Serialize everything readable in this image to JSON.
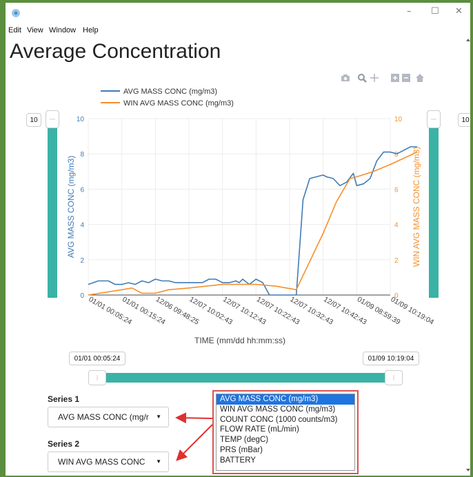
{
  "window": {
    "controls": {
      "minimize": "–",
      "maximize": "☐",
      "close": "✕"
    }
  },
  "menu": [
    "Edit",
    "View",
    "Window",
    "Help"
  ],
  "page": {
    "title": "Average Concentration"
  },
  "toolbar_icons": [
    "camera-icon",
    "zoom-icon",
    "pan-icon",
    "zoom-in-icon",
    "zoom-out-icon",
    "home-icon"
  ],
  "left_axis_slider": {
    "value": "10",
    "level": 1.0
  },
  "right_axis_slider": {
    "value": "10",
    "level": 1.0
  },
  "time_range": {
    "start": "01/01 00:05:24",
    "end": "01/09 10:19:04",
    "start_pos": 0.0,
    "end_pos": 1.0
  },
  "series_controls": {
    "series1": {
      "label": "Series 1",
      "value": "AVG MASS CONC (mg/r"
    },
    "series2": {
      "label": "Series 2",
      "value": "WIN AVG MASS CONC"
    }
  },
  "dropdown": {
    "options": [
      "AVG MASS CONC (mg/m3)",
      "WIN AVG MASS CONC (mg/m3)",
      "COUNT CONC (1000 counts/m3)",
      "FLOW RATE (mL/min)",
      "TEMP (degC)",
      "PRS (mBar)",
      "BATTERY"
    ],
    "selected": 0
  },
  "colors": {
    "series1": "#3f7bb5",
    "series2": "#f58f2d",
    "slider": "#3ab3a6",
    "annotation": "#d9534f",
    "selected": "#1e74e0"
  },
  "chart_data": {
    "type": "line",
    "xlabel": "TIME (mm/dd hh:mm:ss)",
    "ylabel": "AVG MASS CONC (mg/m3)",
    "y2label": "WIN AVG MASS CONC (mg/m3)",
    "ylim": [
      0,
      10
    ],
    "y2lim": [
      0,
      10
    ],
    "yticks": [
      0,
      2,
      4,
      6,
      8,
      10
    ],
    "y2ticks": [
      0,
      2,
      4,
      6,
      8,
      10
    ],
    "xticks": [
      "01/01 00:05:24",
      "01/01 00:15:24",
      "12/06 09:48:25",
      "12/07 10:02:43",
      "12/07 10:12:43",
      "12/07 10:22:43",
      "12/07 10:32:43",
      "12/07 10:42:43",
      "01/09 08:59:39",
      "01/09 10:19:04"
    ],
    "grid": true,
    "legend": "top-left",
    "series": [
      {
        "name": "AVG MASS CONC (mg/m3)",
        "axis": "left",
        "x": [
          0,
          0.3,
          0.6,
          0.8,
          1.0,
          1.2,
          1.4,
          1.6,
          1.8,
          2.0,
          2.2,
          2.4,
          2.6,
          2.8,
          3.0,
          3.2,
          3.4,
          3.6,
          3.8,
          4.0,
          4.2,
          4.4,
          4.5,
          4.6,
          4.8,
          5.0,
          5.2,
          5.4,
          5.6,
          5.8,
          6.0,
          6.2,
          6.4,
          6.6,
          6.8,
          7.0,
          7.1,
          7.3,
          7.5,
          7.7,
          7.9,
          8.0,
          8.2,
          8.4,
          8.6,
          8.8,
          9.0,
          9.2,
          9.4,
          9.6,
          9.8
        ],
        "values": [
          0.6,
          0.8,
          0.8,
          0.6,
          0.6,
          0.7,
          0.6,
          0.8,
          0.7,
          0.9,
          0.8,
          0.8,
          0.7,
          0.7,
          0.7,
          0.7,
          0.7,
          0.9,
          0.9,
          0.7,
          0.7,
          0.8,
          0.7,
          0.9,
          0.6,
          0.9,
          0.7,
          0.0,
          0.0,
          0.0,
          0.0,
          0.0,
          5.4,
          6.6,
          6.7,
          6.8,
          6.7,
          6.6,
          6.2,
          6.4,
          6.9,
          6.2,
          6.3,
          6.6,
          7.6,
          8.1,
          8.1,
          8.0,
          8.2,
          8.4,
          8.4
        ]
      },
      {
        "name": "WIN AVG MASS CONC (mg/m3)",
        "axis": "right",
        "x": [
          0,
          1.0,
          1.3,
          1.6,
          2.0,
          2.4,
          3.0,
          3.5,
          4.0,
          4.5,
          5.0,
          5.6,
          6.2,
          7.0,
          7.4,
          7.8,
          8.0,
          8.5,
          9.0,
          9.8
        ],
        "values": [
          0.0,
          0.3,
          0.4,
          0.1,
          0.1,
          0.3,
          0.4,
          0.5,
          0.6,
          0.6,
          0.6,
          0.5,
          0.3,
          3.5,
          5.3,
          6.6,
          6.7,
          7.0,
          7.4,
          8.1
        ]
      }
    ]
  }
}
